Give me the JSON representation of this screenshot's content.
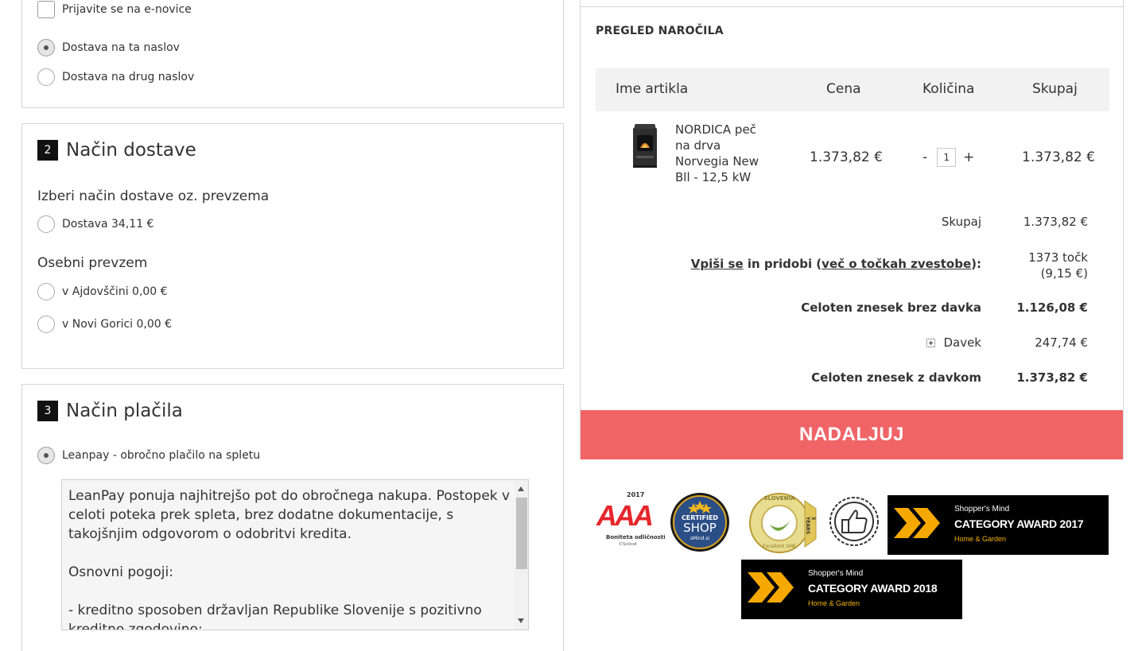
{
  "contact": {
    "newsletter_label": "Prijavite se na e-novice",
    "ship_same_label": "Dostava na ta naslov",
    "ship_other_label": "Dostava na drug naslov"
  },
  "delivery": {
    "number": "2",
    "title": "Način dostave",
    "choose_label": "Izberi način dostave oz. prevzema",
    "delivery_option": "Dostava 34,11 €",
    "pickup_label": "Osebni prevzem",
    "pickup_ajdovscina": "v Ajdovščini 0,00 €",
    "pickup_gorica": "v Novi Gorici 0,00 €"
  },
  "payment": {
    "number": "3",
    "title": "Način plačila",
    "leanpay_label": "Leanpay - obročno plačilo na spletu",
    "leanpay_description": "LeanPay ponuja najhitrejšo pot do obročnega nakupa. Postopek v celoti poteka prek spleta, brez dodatne dokumentacije, s takojšnjim odgovorom o odobritvi kredita.\n\nOsnovni pogoji:\n\n- kreditno sposoben državljan Republike Slovenije s pozitivno kreditno zgodovino;"
  },
  "summary": {
    "title": "PREGLED NAROČILA",
    "col_name": "Ime artikla",
    "col_price": "Cena",
    "col_qty": "Količina",
    "col_total": "Skupaj",
    "item": {
      "name": "NORDICA peč na drva Norvegia New Bll - 12,5 kW",
      "price": "1.373,82 €",
      "qty_minus": "-",
      "qty": "1",
      "qty_plus": "+",
      "total": "1.373,82 €"
    },
    "subtotal_label": "Skupaj",
    "subtotal_value": "1.373,82 €",
    "points_signup": "Vpiši se",
    "points_mid": " in pridobi (",
    "points_link": "več o točkah zvestobe",
    "points_end": "):",
    "points_value": "1373 točk",
    "points_value_eur": "(9,15 €)",
    "net_label": "Celoten znesek brez davka",
    "net_value": "1.126,08 €",
    "tax_label": "Davek",
    "tax_value": "247,74 €",
    "gross_label": "Celoten znesek z davkom",
    "gross_value": "1.373,82 €",
    "continue_button": "NADALJUJ"
  },
  "badges": {
    "aaa_year": "2017",
    "aaa_text": "AAA",
    "aaa_caption": "Boniteta odličnosti",
    "aaa_source": "©Scilicet",
    "certified_top": "CERTIFIED",
    "certified_shop": "SHOP",
    "certified_site": "sMind.si",
    "sme_top": "SLOVENIA",
    "sme_bottom": "Excellent SME",
    "sme_years": "3 YEARS",
    "award_small": "Shopper's Mind",
    "award_2017": "CATEGORY AWARD 2017",
    "award_2018": "CATEGORY AWARD 2018",
    "award_category": "Home & Garden"
  },
  "colors": {
    "cta": "#f06467",
    "award_bg": "#000000",
    "award_accent": "#f5b400"
  }
}
